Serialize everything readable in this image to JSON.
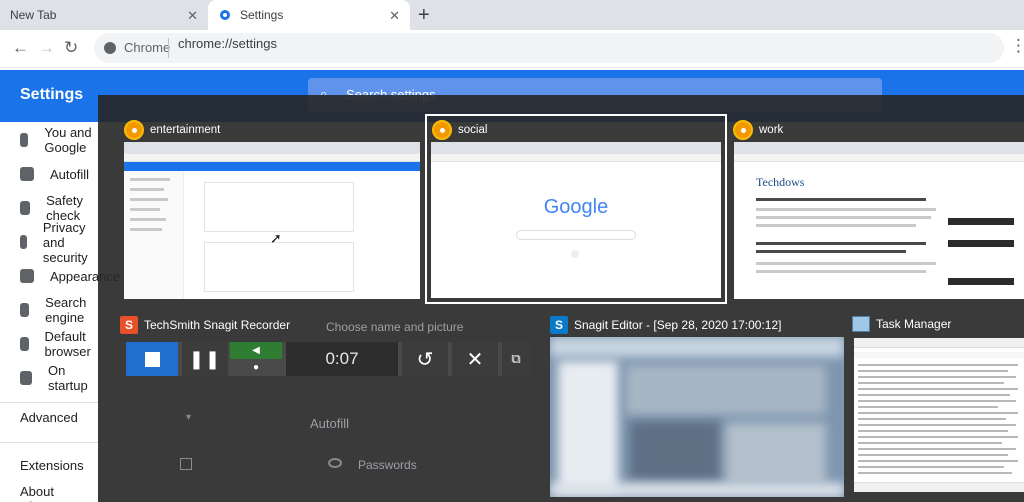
{
  "browser": {
    "tabs": [
      {
        "label": "New Tab"
      },
      {
        "label": "Settings"
      }
    ],
    "omnibox": {
      "chip": "Chrome",
      "url": "chrome://settings"
    }
  },
  "settings": {
    "title": "Settings",
    "search_placeholder": "Search settings",
    "sidebar": [
      {
        "label": "You and Google"
      },
      {
        "label": "Autofill"
      },
      {
        "label": "Safety check"
      },
      {
        "label": "Privacy and security"
      },
      {
        "label": "Appearance"
      },
      {
        "label": "Search engine"
      },
      {
        "label": "Default browser"
      },
      {
        "label": "On startup"
      }
    ],
    "advanced": "Advanced",
    "extensions": "Extensions",
    "about": "About Chrome",
    "main": {
      "choose_label": "Choose name and picture",
      "autofill_label": "Autofill",
      "passwords_label": "Passwords"
    }
  },
  "switcher": {
    "windows": [
      {
        "title": "entertainment",
        "icon": "chrome-profile-icon"
      },
      {
        "title": "social",
        "icon": "chrome-profile-icon",
        "selected": true
      },
      {
        "title": "work",
        "icon": "chrome-profile-icon"
      },
      {
        "title": "TechSmith Snagit Recorder",
        "icon": "snagit-icon"
      },
      {
        "title": "Snagit Editor - [Sep 28, 2020 17:00:12]",
        "icon": "snagit-editor-icon"
      },
      {
        "title": "Task Manager",
        "icon": "task-manager-icon"
      }
    ],
    "thumbnails": {
      "social_logo": "Google",
      "work_site": "Techdows"
    }
  },
  "recorder": {
    "time": "0:07"
  }
}
